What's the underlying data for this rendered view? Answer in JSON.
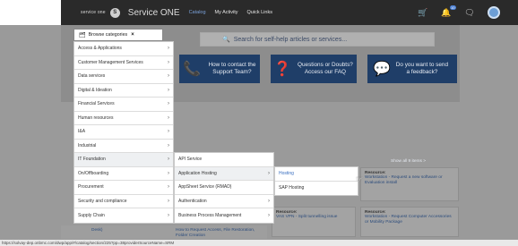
{
  "header": {
    "logo_text": "service one",
    "logo_letter": "S",
    "app_title": "Service ONE",
    "nav": [
      "Catalog",
      "My Activity",
      "Quick Links"
    ],
    "cart_count": "10",
    "icons": [
      "cart-icon",
      "notification-icon",
      "chat-icon",
      "user-avatar"
    ]
  },
  "hero": {
    "search_placeholder": "Search for self-help articles or services...",
    "tiles": [
      {
        "label": "How to contact the Support Team?",
        "icon": "phone-person-icon"
      },
      {
        "label": "Questions or Doubts? Access our FAQ",
        "icon": "qa-bubbles-icon"
      },
      {
        "label": "Do you want to send a feedback?",
        "icon": "feedback-icon"
      }
    ]
  },
  "categories": {
    "header_label": "Browse categories",
    "items": [
      "Access & Applications",
      "Customer Management Services",
      "Data services",
      "Digital & Ideation",
      "Financial Services",
      "Human resources",
      "I&A",
      "Industrial",
      "IT Foundation",
      "On/Offboarding",
      "Procurement",
      "Security and compliance",
      "Supply Chain"
    ],
    "submenu": [
      "API Service",
      "Application Hosting",
      "AppSheet Service (RMAD)",
      "Authentication",
      "Business Process Management"
    ],
    "submenu2": [
      "Hosting",
      "SAP Hosting"
    ]
  },
  "content": {
    "show_all": "Show all 9 items >",
    "cards": [
      {
        "title": "Resource:",
        "link": "Workstation - Request a new software or Evaluation install"
      },
      {
        "title": "Resource:",
        "link": "Workstation - Request Computer Accessories or Mobility Package"
      },
      {
        "title": "Resource:",
        "link": "VAS VPN - Split tunnelling issue"
      },
      {
        "title": "",
        "link": "How to Request Access, File Restoration, Folder Creation"
      },
      {
        "title": "",
        "link": "Desk)"
      }
    ]
  },
  "status_bar": "https://solvay-dep.onbmc.com/dwp/app/#/catalog/section/225?pp=38providerSourceName=SRM"
}
